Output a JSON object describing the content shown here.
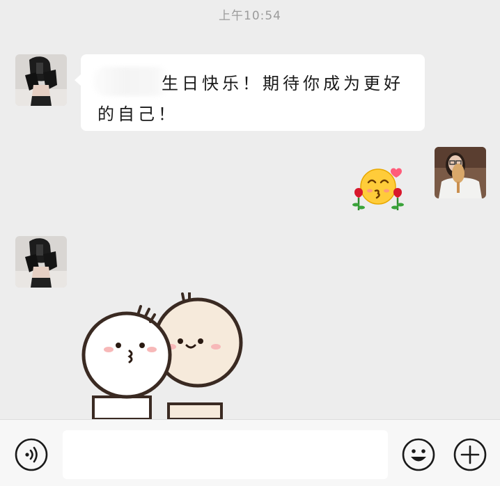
{
  "chat": {
    "timestamp": "上午10:54",
    "messages": [
      {
        "sender": "contact",
        "type": "text",
        "text": "生日快乐！期待你成为更好的自己！"
      },
      {
        "sender": "self",
        "type": "emoji",
        "emoji": "smiling-face-with-roses"
      },
      {
        "sender": "contact",
        "type": "sticker",
        "sticker": "two-round-characters-hugging"
      }
    ]
  },
  "input_bar": {
    "voice_icon": "voice-icon",
    "input_value": "",
    "emoji_icon": "emoji-face-icon",
    "more_icon": "plus-circle-icon"
  },
  "colors": {
    "background": "#ededed",
    "bubble": "#ffffff",
    "timestamp": "#9b9b9b",
    "bar": "#f7f7f7"
  }
}
